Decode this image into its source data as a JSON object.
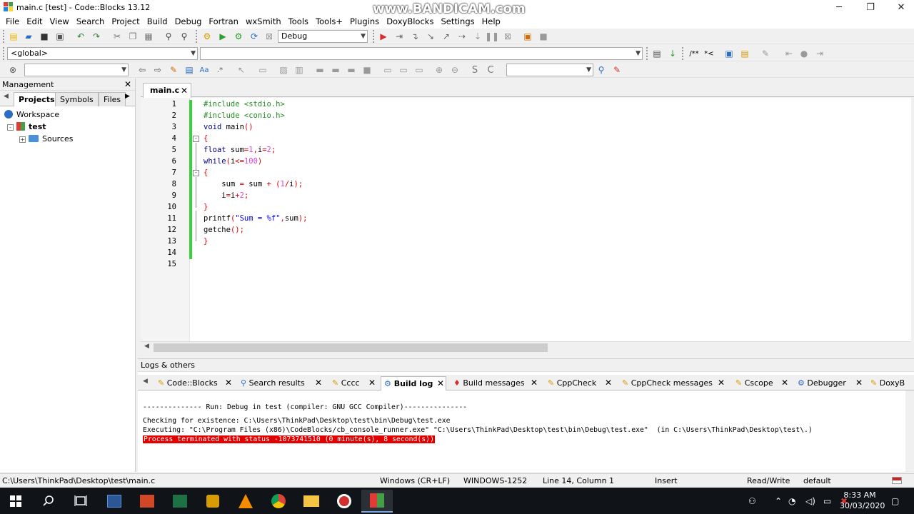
{
  "window": {
    "title": "main.c [test] - Code::Blocks 13.12",
    "watermark": "www.BANDICAM.com",
    "minimize": "─",
    "maximize": "❐",
    "close": "✕"
  },
  "menu": [
    "File",
    "Edit",
    "View",
    "Search",
    "Project",
    "Build",
    "Debug",
    "Fortran",
    "wxSmith",
    "Tools",
    "Tools+",
    "Plugins",
    "DoxyBlocks",
    "Settings",
    "Help"
  ],
  "toolbar": {
    "build_target": "Debug",
    "scope": "<global>",
    "symbol_combo": "",
    "search_combo": "",
    "doxy_comment": "/**",
    "doxy_line": "*<"
  },
  "management": {
    "title": "Management",
    "tabs": [
      "Projects",
      "Symbols",
      "Files"
    ],
    "workspace": "Workspace",
    "project": "test",
    "folder": "Sources"
  },
  "editor": {
    "tab": "main.c",
    "line_numbers": [
      "1",
      "2",
      "3",
      "4",
      "5",
      "6",
      "7",
      "8",
      "9",
      "10",
      "11",
      "12",
      "13",
      "14",
      "15"
    ]
  },
  "logs": {
    "title": "Logs & others",
    "tabs": [
      "Code::Blocks",
      "Search results",
      "Cccc",
      "Build log",
      "Build messages",
      "CppCheck",
      "CppCheck messages",
      "Cscope",
      "Debugger",
      "DoxyB"
    ],
    "lines": [
      "-------------- Run: Debug in test (compiler: GNU GCC Compiler)---------------",
      "Checking for existence: C:\\Users\\ThinkPad\\Desktop\\test\\bin\\Debug\\test.exe",
      "Executing: \"C:\\Program Files (x86)\\CodeBlocks/cb_console_runner.exe\" \"C:\\Users\\ThinkPad\\Desktop\\test\\bin\\Debug\\test.exe\"  (in C:\\Users\\ThinkPad\\Desktop\\test\\.)"
    ],
    "error_line": "Process terminated with status -1073741510 (0 minute(s), 8 second(s))"
  },
  "status": {
    "path": "C:\\Users\\ThinkPad\\Desktop\\test\\main.c",
    "eol": "Windows (CR+LF)",
    "encoding": "WINDOWS-1252",
    "position": "Line 14, Column 1",
    "mode": "Insert",
    "access": "Read/Write",
    "profile": "default"
  },
  "taskbar": {
    "time": "8:33 AM",
    "date": "30/03/2020"
  },
  "colors": {
    "keyword": "#00008b",
    "preprocessor": "#228b22",
    "number": "#e040e0",
    "operator": "#e00000",
    "string": "#0000ff",
    "change_bar": "#3bd13b",
    "error_bg": "#e00000"
  }
}
